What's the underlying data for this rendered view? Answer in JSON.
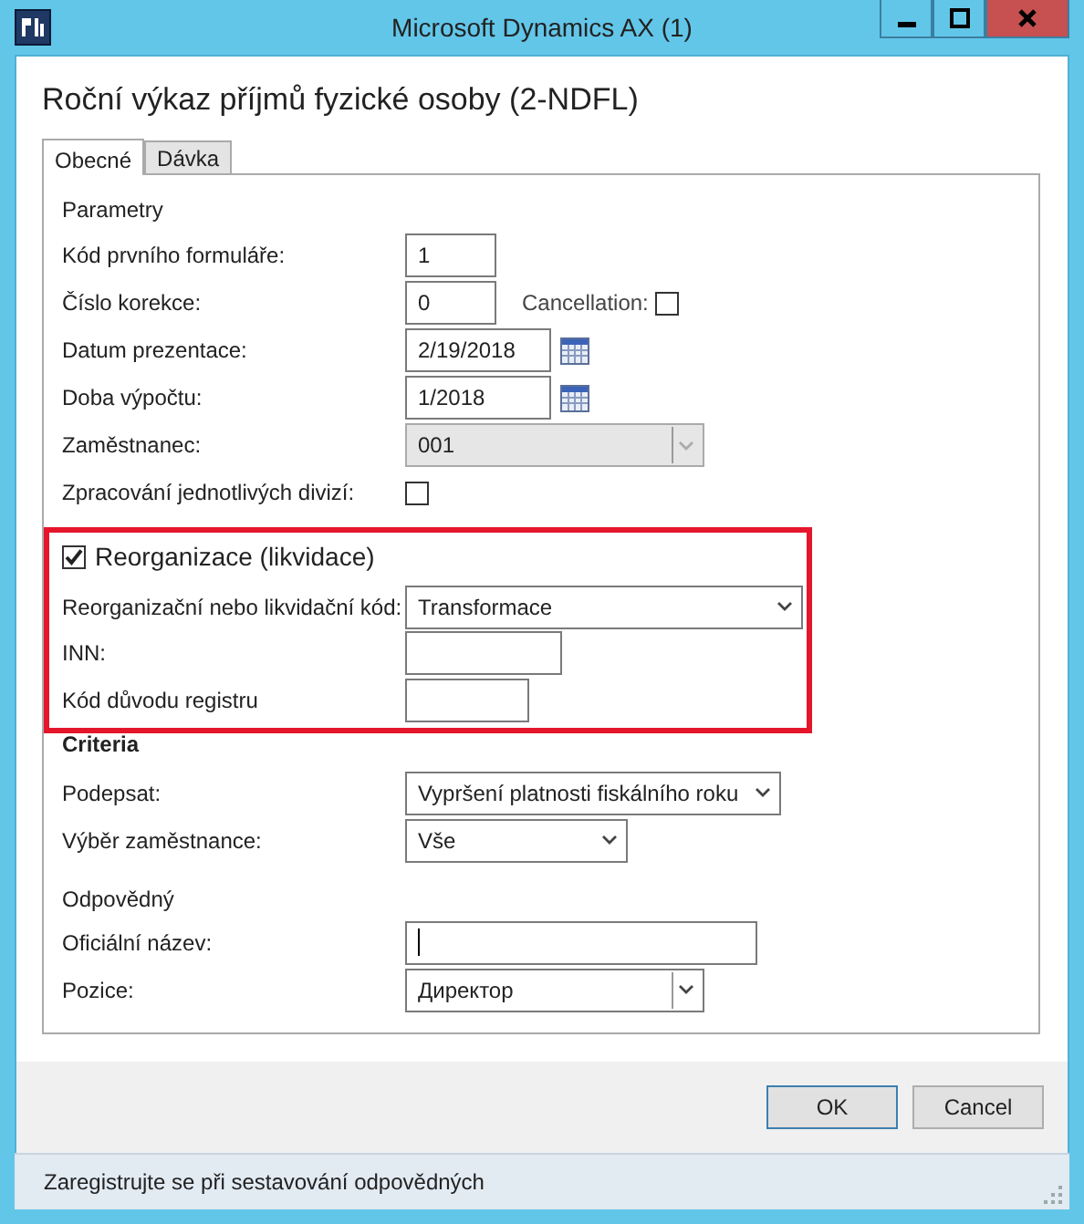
{
  "window": {
    "title": "Microsoft Dynamics AX (1)"
  },
  "form_title": "Roční výkaz příjmů fyzické osoby (2-NDFL)",
  "tabs": [
    {
      "label": "Obecné",
      "selected": true
    },
    {
      "label": "Dávka",
      "selected": false
    }
  ],
  "sections": [
    {
      "kind": "plain",
      "heading": "Parametry",
      "rows": [
        {
          "label": "Kód prvního formuláře:",
          "kind": "number",
          "value": "1"
        },
        {
          "label": "Číslo korekce:",
          "kind": "number",
          "value": "0",
          "extra": {
            "label": "Cancellation:",
            "checked": false
          }
        },
        {
          "label": "Datum prezentace:",
          "kind": "date",
          "value": "2/19/2018"
        },
        {
          "label": "Doba výpočtu:",
          "kind": "date",
          "value": "1/2018"
        },
        {
          "label": "Zaměstnanec:",
          "kind": "combo",
          "value": "001",
          "disabled": true
        },
        {
          "label": "Zpracování jednotlivých divizí:",
          "kind": "checkbox",
          "checked": false
        }
      ]
    },
    {
      "kind": "highlight",
      "checkbox": {
        "label": "Reorganizace (likvidace)",
        "checked": true
      },
      "rows": [
        {
          "label": "Reorganizační nebo likvidační kód:",
          "kind": "combo",
          "value": "Transformace",
          "disabled": false
        },
        {
          "label": "INN:",
          "kind": "text"
        },
        {
          "label": "Kód důvodu registru",
          "kind": "text"
        }
      ]
    },
    {
      "kind": "bold",
      "heading": "Criteria",
      "rows": [
        {
          "label": "Podepsat:",
          "kind": "combo",
          "value": "Vypršení platnosti fiskálního roku",
          "disabled": false
        },
        {
          "label": "Výběr zaměstnance:",
          "kind": "combo",
          "value": "Vše",
          "disabled": false
        }
      ]
    },
    {
      "kind": "plain",
      "heading": "Odpovědný",
      "rows": [
        {
          "label": "Oficiální název:",
          "kind": "text",
          "focused": true
        },
        {
          "label": "Pozice:",
          "kind": "combo",
          "value": "Директор",
          "disabled": false
        }
      ]
    }
  ],
  "buttons": [
    "OK",
    "Cancel"
  ],
  "status_bar": "Zaregistrujte se při sestavování odpovědných"
}
